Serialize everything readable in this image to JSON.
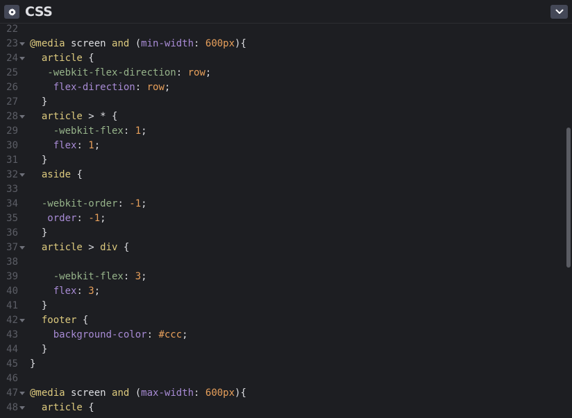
{
  "header": {
    "title": "CSS",
    "settings_icon": "gear-icon",
    "collapse_icon": "chevron-down-icon"
  },
  "colors": {
    "background": "#1d1e22",
    "button_bg": "#444857",
    "keyword": "#ddca7e",
    "property": "#a88bd5",
    "vendor_property": "#96b38a",
    "number": "#e8a05b",
    "line_number": "#5c5e66"
  },
  "lines": [
    {
      "n": "22",
      "fold": false,
      "tokens": []
    },
    {
      "n": "23",
      "fold": true,
      "tokens": [
        [
          "kw",
          "@media"
        ],
        [
          "plain",
          " screen "
        ],
        [
          "kw",
          "and"
        ],
        [
          "plain",
          " ("
        ],
        [
          "prop",
          "min-width"
        ],
        [
          "plain",
          ": "
        ],
        [
          "num",
          "600px"
        ],
        [
          "plain",
          "){"
        ]
      ]
    },
    {
      "n": "24",
      "fold": true,
      "tokens": [
        [
          "plain",
          "  "
        ],
        [
          "sel",
          "article"
        ],
        [
          "plain",
          " {"
        ]
      ]
    },
    {
      "n": "25",
      "fold": false,
      "tokens": [
        [
          "plain",
          "   "
        ],
        [
          "propwk",
          "-webkit-flex-direction"
        ],
        [
          "plain",
          ": "
        ],
        [
          "val",
          "row"
        ],
        [
          "plain",
          ";"
        ]
      ]
    },
    {
      "n": "26",
      "fold": false,
      "tokens": [
        [
          "plain",
          "    "
        ],
        [
          "prop",
          "flex-direction"
        ],
        [
          "plain",
          ": "
        ],
        [
          "val",
          "row"
        ],
        [
          "plain",
          ";"
        ]
      ]
    },
    {
      "n": "27",
      "fold": false,
      "tokens": [
        [
          "plain",
          "  }"
        ]
      ]
    },
    {
      "n": "28",
      "fold": true,
      "tokens": [
        [
          "plain",
          "  "
        ],
        [
          "sel",
          "article"
        ],
        [
          "plain",
          " > * {"
        ]
      ]
    },
    {
      "n": "29",
      "fold": false,
      "tokens": [
        [
          "plain",
          "    "
        ],
        [
          "propwk",
          "-webkit-flex"
        ],
        [
          "plain",
          ": "
        ],
        [
          "num",
          "1"
        ],
        [
          "plain",
          ";"
        ]
      ]
    },
    {
      "n": "30",
      "fold": false,
      "tokens": [
        [
          "plain",
          "    "
        ],
        [
          "prop",
          "flex"
        ],
        [
          "plain",
          ": "
        ],
        [
          "num",
          "1"
        ],
        [
          "plain",
          ";"
        ]
      ]
    },
    {
      "n": "31",
      "fold": false,
      "tokens": [
        [
          "plain",
          "  }"
        ]
      ]
    },
    {
      "n": "32",
      "fold": true,
      "tokens": [
        [
          "plain",
          "  "
        ],
        [
          "sel",
          "aside"
        ],
        [
          "plain",
          " {"
        ]
      ]
    },
    {
      "n": "33",
      "fold": false,
      "tokens": []
    },
    {
      "n": "34",
      "fold": false,
      "tokens": [
        [
          "plain",
          "  "
        ],
        [
          "propwk",
          "-webkit-order"
        ],
        [
          "plain",
          ": "
        ],
        [
          "num",
          "-1"
        ],
        [
          "plain",
          ";"
        ]
      ]
    },
    {
      "n": "35",
      "fold": false,
      "tokens": [
        [
          "plain",
          "   "
        ],
        [
          "prop",
          "order"
        ],
        [
          "plain",
          ": "
        ],
        [
          "num",
          "-1"
        ],
        [
          "plain",
          ";"
        ]
      ]
    },
    {
      "n": "36",
      "fold": false,
      "tokens": [
        [
          "plain",
          "  }"
        ]
      ]
    },
    {
      "n": "37",
      "fold": true,
      "tokens": [
        [
          "plain",
          "  "
        ],
        [
          "sel",
          "article"
        ],
        [
          "plain",
          " > "
        ],
        [
          "sel",
          "div"
        ],
        [
          "plain",
          " {"
        ]
      ]
    },
    {
      "n": "38",
      "fold": false,
      "tokens": []
    },
    {
      "n": "39",
      "fold": false,
      "tokens": [
        [
          "plain",
          "    "
        ],
        [
          "propwk",
          "-webkit-flex"
        ],
        [
          "plain",
          ": "
        ],
        [
          "num",
          "3"
        ],
        [
          "plain",
          ";"
        ]
      ]
    },
    {
      "n": "40",
      "fold": false,
      "tokens": [
        [
          "plain",
          "    "
        ],
        [
          "prop",
          "flex"
        ],
        [
          "plain",
          ": "
        ],
        [
          "num",
          "3"
        ],
        [
          "plain",
          ";"
        ]
      ]
    },
    {
      "n": "41",
      "fold": false,
      "tokens": [
        [
          "plain",
          "  }"
        ]
      ]
    },
    {
      "n": "42",
      "fold": true,
      "tokens": [
        [
          "plain",
          "  "
        ],
        [
          "sel",
          "footer"
        ],
        [
          "plain",
          " {"
        ]
      ]
    },
    {
      "n": "43",
      "fold": false,
      "tokens": [
        [
          "plain",
          "    "
        ],
        [
          "prop",
          "background-color"
        ],
        [
          "plain",
          ": "
        ],
        [
          "val",
          "#ccc"
        ],
        [
          "plain",
          ";"
        ]
      ]
    },
    {
      "n": "44",
      "fold": false,
      "tokens": [
        [
          "plain",
          "  }"
        ]
      ]
    },
    {
      "n": "45",
      "fold": false,
      "tokens": [
        [
          "plain",
          "}"
        ]
      ]
    },
    {
      "n": "46",
      "fold": false,
      "tokens": []
    },
    {
      "n": "47",
      "fold": true,
      "tokens": [
        [
          "kw",
          "@media"
        ],
        [
          "plain",
          " screen "
        ],
        [
          "kw",
          "and"
        ],
        [
          "plain",
          " ("
        ],
        [
          "prop",
          "max-width"
        ],
        [
          "plain",
          ": "
        ],
        [
          "num",
          "600px"
        ],
        [
          "plain",
          "){"
        ]
      ]
    },
    {
      "n": "48",
      "fold": true,
      "tokens": [
        [
          "plain",
          "  "
        ],
        [
          "sel",
          "article"
        ],
        [
          "plain",
          " {"
        ]
      ]
    }
  ]
}
